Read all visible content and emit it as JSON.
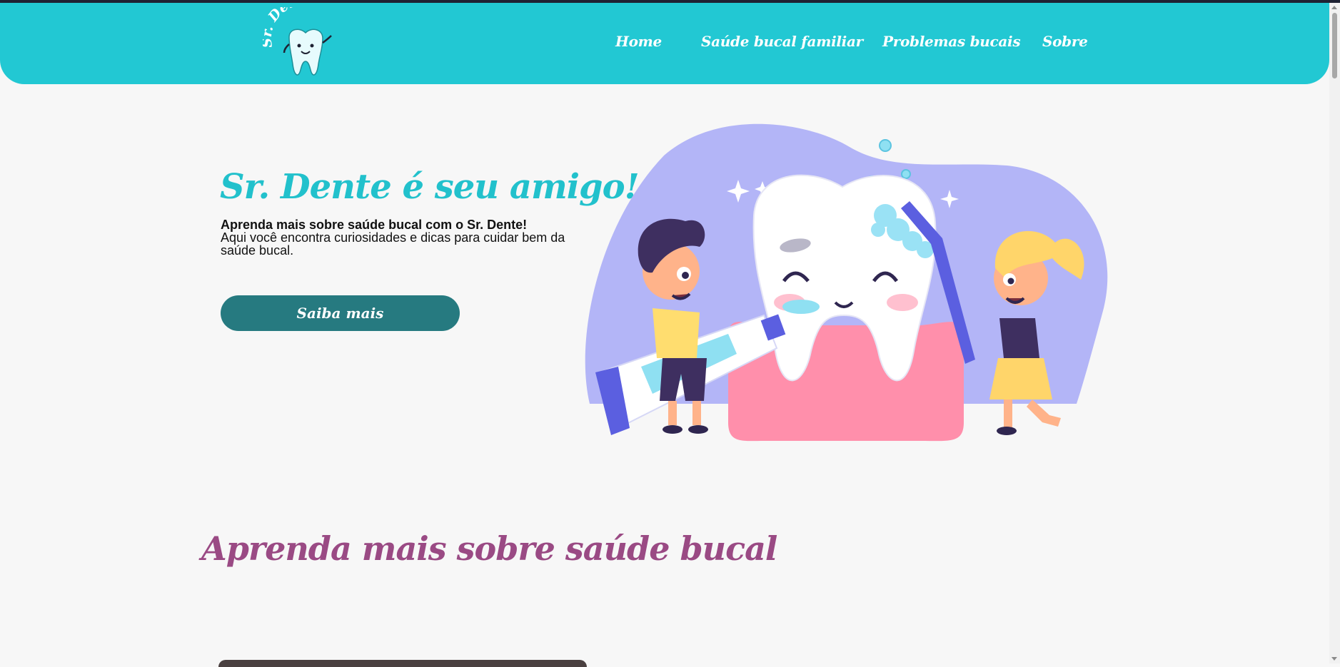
{
  "brand": {
    "logo_text": "Sr. Dente"
  },
  "nav": {
    "links": [
      {
        "label": "Home"
      },
      {
        "label": "Saúde bucal familiar"
      },
      {
        "label": "Problemas bucais"
      },
      {
        "label": "Sobre"
      }
    ]
  },
  "hero": {
    "title": "Sr. Dente é seu amigo!",
    "subtitle_bold": "Aprenda mais sobre saúde bucal com o Sr. Dente!",
    "description": "Aqui você encontra curiosidades e dicas para cuidar bem da saúde bucal.",
    "cta_label": "Saiba mais"
  },
  "section": {
    "title": "Aprenda mais sobre saúde bucal"
  },
  "colors": {
    "header": "#22c8d3",
    "hero_title": "#22c1cc",
    "cta": "#267a80",
    "section_title": "#9a4a84",
    "illustration_bg": "#b3b5f7"
  }
}
